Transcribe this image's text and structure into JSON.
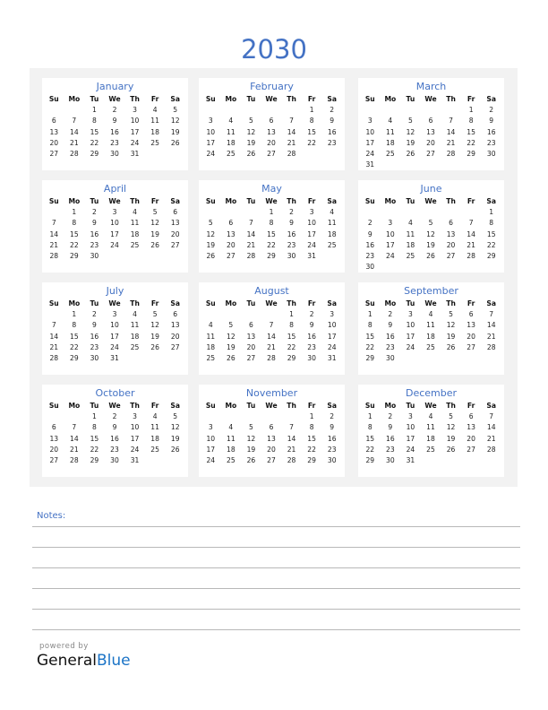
{
  "year": "2030",
  "weekdays": [
    "Su",
    "Mo",
    "Tu",
    "We",
    "Th",
    "Fr",
    "Sa"
  ],
  "months": [
    {
      "name": "January",
      "first_weekday": 2,
      "days": 31
    },
    {
      "name": "February",
      "first_weekday": 5,
      "days": 28
    },
    {
      "name": "March",
      "first_weekday": 5,
      "days": 31
    },
    {
      "name": "April",
      "first_weekday": 1,
      "days": 30
    },
    {
      "name": "May",
      "first_weekday": 3,
      "days": 31
    },
    {
      "name": "June",
      "first_weekday": 6,
      "days": 30
    },
    {
      "name": "July",
      "first_weekday": 1,
      "days": 31
    },
    {
      "name": "August",
      "first_weekday": 4,
      "days": 31
    },
    {
      "name": "September",
      "first_weekday": 0,
      "days": 30
    },
    {
      "name": "October",
      "first_weekday": 2,
      "days": 31
    },
    {
      "name": "November",
      "first_weekday": 5,
      "days": 30
    },
    {
      "name": "December",
      "first_weekday": 0,
      "days": 31
    }
  ],
  "notes": {
    "label": "Notes:"
  },
  "footer": {
    "powered_by": "powered by",
    "brand_general": "General",
    "brand_blue": "Blue"
  },
  "colors": {
    "accent": "#4472c4",
    "panel": "#f2f2f2",
    "brand_blue": "#1a73c6"
  }
}
